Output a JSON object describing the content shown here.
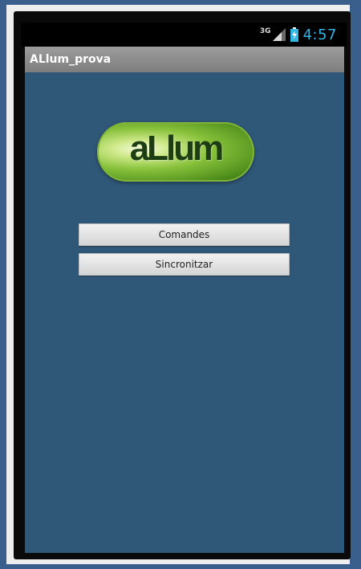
{
  "status_bar": {
    "network": "3G",
    "time": "4:57",
    "signal_icon": "signal-icon",
    "battery_icon": "battery-charging-icon"
  },
  "app": {
    "title": "ALlum_prova"
  },
  "logo": {
    "text": "aLlum"
  },
  "buttons": {
    "comandes": "Comandes",
    "sincronitzar": "Sincronitzar"
  },
  "colors": {
    "background": "#2f5777",
    "action_bar": "#8a8a8a",
    "clock": "#33b5e5",
    "logo_green": "#87c13a"
  }
}
